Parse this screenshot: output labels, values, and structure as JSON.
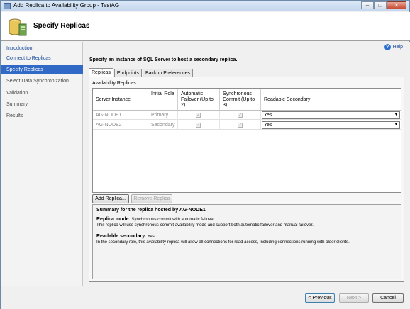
{
  "window": {
    "title": "Add Replica to Availability Group - TestAG"
  },
  "header": {
    "title": "Specify Replicas"
  },
  "sidebar": {
    "items": [
      {
        "label": "Introduction",
        "state": "link"
      },
      {
        "label": "Connect to Replicas",
        "state": "link"
      },
      {
        "label": "Specify Replicas",
        "state": "active"
      },
      {
        "label": "Select Data Synchronization",
        "state": "normal"
      },
      {
        "label": "Validation",
        "state": "normal"
      },
      {
        "label": "Summary",
        "state": "normal"
      },
      {
        "label": "Results",
        "state": "normal"
      }
    ]
  },
  "content": {
    "help_label": "Help",
    "instruction": "Specify an instance of SQL Server to host a secondary replica.",
    "tabs": [
      {
        "label": "Replicas",
        "active": true
      },
      {
        "label": "Endpoints",
        "active": false
      },
      {
        "label": "Backup Preferences",
        "active": false
      }
    ],
    "replicas_label": "Availability Replicas:",
    "grid": {
      "headers": {
        "server_instance": "Server Instance",
        "initial_role": "Initial Role",
        "auto_failover": "Automatic Failover (Up to 2)",
        "sync_commit": "Synchronous Commit (Up to 3)",
        "readable_secondary": "Readable Secondary"
      },
      "rows": [
        {
          "server_instance": "AG-NODE1",
          "initial_role": "Primary",
          "auto_failover": true,
          "sync_commit": true,
          "readable_secondary": "Yes"
        },
        {
          "server_instance": "AG-NODE2",
          "initial_role": "Secondary",
          "auto_failover": true,
          "sync_commit": true,
          "readable_secondary": "Yes"
        }
      ]
    },
    "add_replica_label": "Add Replica...",
    "remove_replica_label": "Remove Replica",
    "summary": {
      "title": "Summary for the replica hosted by AG-NODE1",
      "replica_mode_label": "Replica mode:",
      "replica_mode_value": "Synchronous commit with automatic failover",
      "replica_mode_desc": "This replica will use synchronous-commit availability mode and support both automatic failover and manual failover.",
      "readable_label": "Readable secondary:",
      "readable_value": "Yes",
      "readable_desc": "In the secondary role, this availability replica will allow all connections for read access, including connections running with older clients."
    }
  },
  "footer": {
    "previous_label": "< Previous",
    "next_label": "Next >",
    "cancel_label": "Cancel"
  },
  "colors": {
    "active_nav": "#3169c6",
    "link": "#1a4a9b",
    "title_bar": "#c4d7ee"
  }
}
